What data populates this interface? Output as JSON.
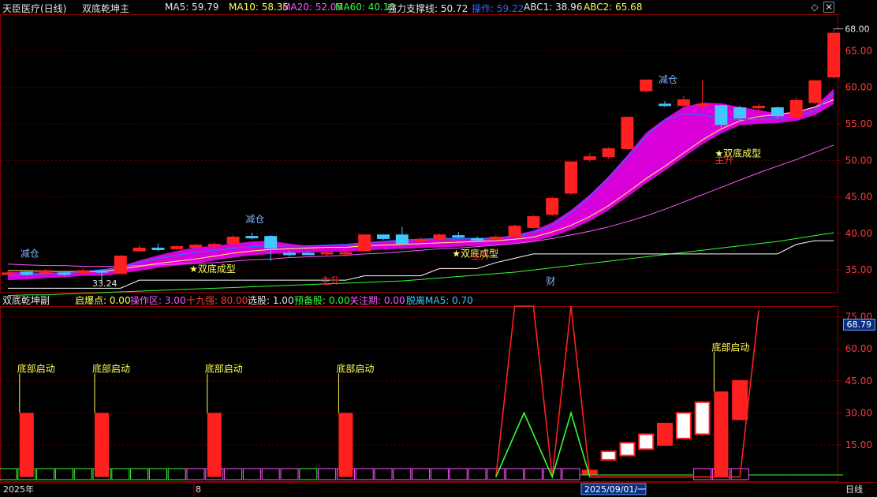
{
  "header": {
    "stock": "天臣医疗(日线)",
    "indicator": "双底乾坤主",
    "ma5": "MA5: 59.79",
    "ma10": "MA10: 58.35",
    "ma20": "MA20: 52.05",
    "ma60": "MA60: 40.10",
    "support": "强力支撑线: 50.72",
    "op": "操作: 59.22",
    "abc1": "ABC1: 38.96",
    "abc2": "ABC2: 65.68",
    "diamond_icon": "diamond-icon",
    "close_icon": "close-icon"
  },
  "sub_header": {
    "name": "双底乾坤副",
    "qbd": "启爆点: 0.00",
    "czq": "操作区: 3.00",
    "sjq": "十九强: 80.00",
    "xg": "选股: 1.00",
    "ybg": "预备股: 0.00",
    "gzq": "关注期: 0.00",
    "tlma5": "脱离MA5: 0.70"
  },
  "colors": {
    "up": "#ff2020",
    "down": "#3ec8ff",
    "ma5": "#ffffff",
    "ma10": "#ffff55",
    "ma20": "#ff55ff",
    "ma60": "#33ff33",
    "band": "#ff00ff",
    "grid": "#8b0000",
    "axis_text": "#ff3b3b"
  },
  "chart_data": [
    {
      "type": "line",
      "panel": "main",
      "title": "双底乾坤主",
      "ylim": [
        32,
        70
      ],
      "y_ticks": [
        "35.00",
        "40.00",
        "45.00",
        "50.00",
        "55.00",
        "60.00",
        "65.00"
      ],
      "price_high_label": "68.00",
      "price_low_label": "33.24",
      "candles": [
        {
          "o": 34.6,
          "c": 34.6,
          "h": 34.9,
          "l": 34.3
        },
        {
          "o": 34.7,
          "c": 34.4,
          "h": 34.9,
          "l": 34.2
        },
        {
          "o": 34.6,
          "c": 34.9,
          "h": 35.1,
          "l": 34.4
        },
        {
          "o": 34.6,
          "c": 34.4,
          "h": 34.8,
          "l": 34.2
        },
        {
          "o": 34.6,
          "c": 34.9,
          "h": 35.2,
          "l": 34.4
        },
        {
          "o": 34.9,
          "c": 34.7,
          "h": 35.1,
          "l": 33.2
        },
        {
          "o": 34.5,
          "c": 36.9,
          "h": 37.0,
          "l": 34.5
        },
        {
          "o": 37.6,
          "c": 38.0,
          "h": 38.4,
          "l": 37.5
        },
        {
          "o": 38.0,
          "c": 37.9,
          "h": 38.6,
          "l": 37.6
        },
        {
          "o": 37.9,
          "c": 38.2,
          "h": 38.4,
          "l": 37.7
        },
        {
          "o": 38.1,
          "c": 38.4,
          "h": 38.6,
          "l": 37.9
        },
        {
          "o": 38.3,
          "c": 38.5,
          "h": 38.8,
          "l": 38.1
        },
        {
          "o": 38.6,
          "c": 39.5,
          "h": 39.8,
          "l": 38.4
        },
        {
          "o": 39.6,
          "c": 39.4,
          "h": 40.1,
          "l": 39.2
        },
        {
          "o": 39.6,
          "c": 38.0,
          "h": 39.8,
          "l": 36.2
        },
        {
          "o": 37.3,
          "c": 37.1,
          "h": 37.6,
          "l": 36.8
        },
        {
          "o": 37.3,
          "c": 37.2,
          "h": 37.5,
          "l": 37.0
        },
        {
          "o": 37.2,
          "c": 37.4,
          "h": 37.6,
          "l": 37.0
        },
        {
          "o": 37.2,
          "c": 37.4,
          "h": 37.6,
          "l": 36.8
        },
        {
          "o": 37.6,
          "c": 39.8,
          "h": 39.8,
          "l": 37.5
        },
        {
          "o": 39.8,
          "c": 39.3,
          "h": 39.9,
          "l": 39.1
        },
        {
          "o": 39.8,
          "c": 38.6,
          "h": 40.9,
          "l": 38.5
        },
        {
          "o": 38.9,
          "c": 39.2,
          "h": 39.5,
          "l": 38.7
        },
        {
          "o": 39.2,
          "c": 39.8,
          "h": 40.0,
          "l": 38.9
        },
        {
          "o": 39.7,
          "c": 39.6,
          "h": 40.2,
          "l": 39.3
        },
        {
          "o": 39.3,
          "c": 39.1,
          "h": 39.6,
          "l": 38.9
        },
        {
          "o": 39.3,
          "c": 39.5,
          "h": 39.8,
          "l": 39.0
        },
        {
          "o": 39.6,
          "c": 41.0,
          "h": 41.2,
          "l": 39.4
        },
        {
          "o": 40.8,
          "c": 42.3,
          "h": 42.5,
          "l": 40.6
        },
        {
          "o": 42.6,
          "c": 44.8,
          "h": 45.0,
          "l": 42.4
        },
        {
          "o": 45.5,
          "c": 49.8,
          "h": 49.8,
          "l": 45.3
        },
        {
          "o": 50.1,
          "c": 50.5,
          "h": 51.0,
          "l": 49.8
        },
        {
          "o": 50.5,
          "c": 51.6,
          "h": 51.8,
          "l": 50.2
        },
        {
          "o": 51.6,
          "c": 55.9,
          "h": 56.0,
          "l": 51.5
        },
        {
          "o": 59.5,
          "c": 61.0,
          "h": 61.0,
          "l": 59.3
        },
        {
          "o": 57.7,
          "c": 57.5,
          "h": 58.1,
          "l": 57.3
        },
        {
          "o": 57.5,
          "c": 58.3,
          "h": 58.8,
          "l": 57.3
        },
        {
          "o": 57.5,
          "c": 57.7,
          "h": 61.0,
          "l": 57.1
        },
        {
          "o": 57.5,
          "c": 54.9,
          "h": 57.6,
          "l": 54.4
        },
        {
          "o": 57.2,
          "c": 55.8,
          "h": 57.5,
          "l": 55.3
        },
        {
          "o": 57.2,
          "c": 57.4,
          "h": 57.7,
          "l": 56.3
        },
        {
          "o": 57.2,
          "c": 56.1,
          "h": 57.4,
          "l": 55.8
        },
        {
          "o": 55.9,
          "c": 58.2,
          "h": 58.6,
          "l": 55.9
        },
        {
          "o": 57.9,
          "c": 60.9,
          "h": 61.0,
          "l": 57.7
        },
        {
          "o": 61.4,
          "c": 67.4,
          "h": 68.0,
          "l": 61.2
        }
      ],
      "ma5": [
        34.7,
        34.7,
        34.6,
        34.7,
        34.8,
        34.8,
        35.5,
        36.3,
        37.0,
        37.6,
        38.1,
        38.3,
        38.6,
        38.9,
        39.0,
        38.6,
        38.3,
        38.0,
        37.6,
        38.0,
        38.4,
        38.8,
        39.0,
        39.2,
        39.3,
        39.3,
        39.4,
        39.8,
        40.4,
        41.5,
        43.2,
        45.3,
        47.8,
        50.7,
        53.8,
        55.7,
        57.3,
        57.9,
        57.8,
        57.3,
        56.9,
        56.4,
        56.7,
        57.4,
        59.8
      ],
      "ma10": [
        34.9,
        34.9,
        34.8,
        34.8,
        34.8,
        34.8,
        35.1,
        35.5,
        35.9,
        36.2,
        36.5,
        36.9,
        37.3,
        37.6,
        37.8,
        37.9,
        38.0,
        38.1,
        38.1,
        38.3,
        38.4,
        38.5,
        38.6,
        38.7,
        38.8,
        38.9,
        39.0,
        39.2,
        39.5,
        40.2,
        41.1,
        42.3,
        43.8,
        45.6,
        47.5,
        49.2,
        51.0,
        52.8,
        54.3,
        55.4,
        56.0,
        56.3,
        56.6,
        57.3,
        58.3
      ],
      "ma20": [
        35.8,
        35.7,
        35.6,
        35.6,
        35.5,
        35.5,
        35.5,
        35.6,
        35.7,
        35.8,
        35.9,
        36.0,
        36.2,
        36.4,
        36.5,
        36.7,
        36.8,
        36.9,
        37.0,
        37.2,
        37.3,
        37.5,
        37.7,
        37.9,
        38.0,
        38.2,
        38.4,
        38.6,
        38.9,
        39.3,
        39.8,
        40.3,
        40.9,
        41.6,
        42.4,
        43.3,
        44.3,
        45.3,
        46.3,
        47.3,
        48.3,
        49.2,
        50.1,
        51.1,
        52.1
      ],
      "ma60": [
        31.5,
        31.6,
        31.6,
        31.7,
        31.8,
        31.9,
        32.0,
        32.1,
        32.2,
        32.3,
        32.4,
        32.5,
        32.6,
        32.7,
        32.8,
        32.9,
        33.0,
        33.1,
        33.2,
        33.3,
        33.4,
        33.5,
        33.7,
        33.9,
        34.1,
        34.3,
        34.5,
        34.7,
        35.0,
        35.3,
        35.6,
        35.9,
        36.2,
        36.5,
        36.8,
        37.1,
        37.4,
        37.7,
        38.0,
        38.3,
        38.6,
        38.9,
        39.3,
        39.7,
        40.1
      ],
      "support_line": [
        32.5,
        32.5,
        32.5,
        32.5,
        32.5,
        32.5,
        32.5,
        33.6,
        33.6,
        33.6,
        33.6,
        33.6,
        33.6,
        33.6,
        33.6,
        33.6,
        33.6,
        33.6,
        33.6,
        34.2,
        34.2,
        34.2,
        34.2,
        35.2,
        35.2,
        35.2,
        36.0,
        36.6,
        37.2,
        37.2,
        37.2,
        37.2,
        37.2,
        37.2,
        37.2,
        37.2,
        37.2,
        37.2,
        37.2,
        37.2,
        37.2,
        37.2,
        38.5,
        39.0,
        39.0
      ],
      "op_line": [
        34.2,
        34.3,
        34.5,
        34.6,
        34.8,
        35.0,
        35.4,
        36.0,
        36.6,
        37.0,
        37.4,
        37.7,
        38.0,
        38.2,
        38.3,
        38.3,
        38.3,
        38.4,
        38.5,
        38.7,
        38.9,
        39.1,
        39.2,
        39.3,
        39.3,
        39.3,
        39.4,
        39.6,
        40.1,
        41.1,
        42.8,
        45.0,
        47.6,
        50.4,
        53.3,
        55.5,
        56.4,
        56.2,
        55.7,
        55.6,
        55.6,
        55.7,
        56.0,
        56.8,
        59.2
      ],
      "labels": [
        {
          "i": 1,
          "price": 36.8,
          "text": "减仓",
          "color": "#7fb0ff"
        },
        {
          "i": 13,
          "price": 41.5,
          "text": "减仓",
          "color": "#7fb0ff"
        },
        {
          "i": 35,
          "price": 60.6,
          "text": "减仓",
          "color": "#7fb0ff"
        },
        {
          "i": 10,
          "price": 34.7,
          "text": "★双底成型",
          "color": "#ffff66"
        },
        {
          "i": 24,
          "price": 36.8,
          "text": "★双底成型",
          "color": "#ffff66"
        },
        {
          "i": 38,
          "price": 50.5,
          "text": "★双底成型",
          "color": "#ffff66"
        },
        {
          "i": 17,
          "price": 33.1,
          "text": "主升",
          "color": "#ff3030"
        },
        {
          "i": 25,
          "price": 36.5,
          "text": "主升",
          "color": "#ff3030"
        },
        {
          "i": 38,
          "price": 49.6,
          "text": "主升",
          "color": "#ff3030"
        },
        {
          "i": 29,
          "price": 33.0,
          "text": "财",
          "color": "#7fb0ff"
        }
      ]
    },
    {
      "type": "bar",
      "panel": "sub",
      "title": "双底乾坤副",
      "ylim": [
        -2,
        80
      ],
      "y_ticks": [
        "15.00",
        "30.00",
        "45.00",
        "60.00",
        "75.00"
      ],
      "current_value": "68.79",
      "x_labels": [
        "2025年",
        "8",
        "2025/09/01/一",
        "日线"
      ],
      "bottom_start_bars": [
        {
          "i": 1,
          "value": 30
        },
        {
          "i": 5,
          "value": 30
        },
        {
          "i": 11,
          "value": 30
        },
        {
          "i": 18,
          "value": 30
        },
        {
          "i": 38,
          "value": 40
        }
      ],
      "bottom_start_label": "底部启动",
      "box_bars": [
        {
          "i": 31,
          "lo": 3,
          "hi": 3,
          "filled": true
        },
        {
          "i": 32,
          "lo": 8,
          "hi": 12,
          "filled": false
        },
        {
          "i": 33,
          "lo": 10,
          "hi": 16,
          "filled": false
        },
        {
          "i": 34,
          "lo": 13,
          "hi": 20,
          "filled": false
        },
        {
          "i": 35,
          "lo": 15,
          "hi": 25,
          "filled": true
        },
        {
          "i": 36,
          "lo": 18,
          "hi": 30,
          "filled": false
        },
        {
          "i": 37,
          "lo": 20,
          "hi": 35,
          "filled": false
        },
        {
          "i": 39,
          "lo": 27,
          "hi": 45,
          "filled": true
        }
      ],
      "red_line": [
        {
          "i": 26.0,
          "v": 0
        },
        {
          "i": 27.0,
          "v": 80
        },
        {
          "i": 28.0,
          "v": 80
        },
        {
          "i": 29.0,
          "v": 0
        },
        {
          "i": 30.0,
          "v": 80
        },
        {
          "i": 31.0,
          "v": 0
        },
        {
          "i": 39.0,
          "v": 0
        },
        {
          "i": 40.0,
          "v": 78
        }
      ],
      "green_line": [
        {
          "i": 26.0,
          "v": 0
        },
        {
          "i": 27.5,
          "v": 30
        },
        {
          "i": 29.0,
          "v": 0
        },
        {
          "i": 30.0,
          "v": 30
        },
        {
          "i": 31.0,
          "v": 0
        }
      ],
      "strip_green_ranges": [
        [
          0,
          9
        ],
        [
          16,
          17
        ]
      ],
      "strip_magenta_ranges": [
        [
          10,
          15
        ],
        [
          17,
          30
        ],
        [
          37,
          39
        ]
      ]
    }
  ]
}
